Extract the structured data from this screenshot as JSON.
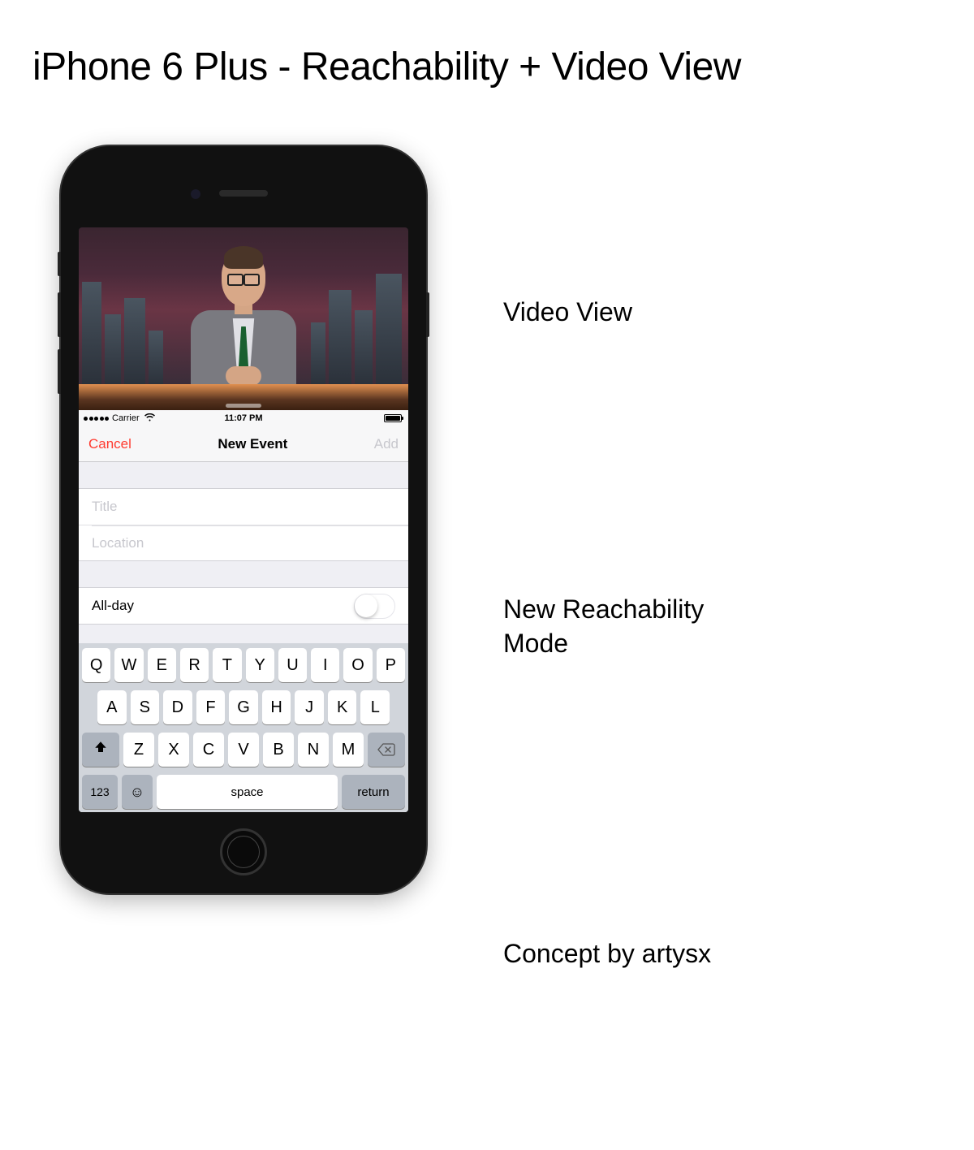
{
  "page": {
    "title": "iPhone 6 Plus - Reachability + Video View"
  },
  "annotations": {
    "video": "Video View",
    "reachability": "New Reachability\nMode",
    "credit": "Concept by artysx"
  },
  "statusbar": {
    "carrier": "Carrier",
    "time": "11:07 PM"
  },
  "navbar": {
    "cancel": "Cancel",
    "title": "New Event",
    "add": "Add"
  },
  "form": {
    "title_placeholder": "Title",
    "location_placeholder": "Location",
    "allday_label": "All-day",
    "allday_on": false
  },
  "keyboard": {
    "row1": [
      "Q",
      "W",
      "E",
      "R",
      "T",
      "Y",
      "U",
      "I",
      "O",
      "P"
    ],
    "row2": [
      "A",
      "S",
      "D",
      "F",
      "G",
      "H",
      "J",
      "K",
      "L"
    ],
    "row3": [
      "Z",
      "X",
      "C",
      "V",
      "B",
      "N",
      "M"
    ],
    "numkey": "123",
    "space": "space",
    "returnkey": "return"
  }
}
